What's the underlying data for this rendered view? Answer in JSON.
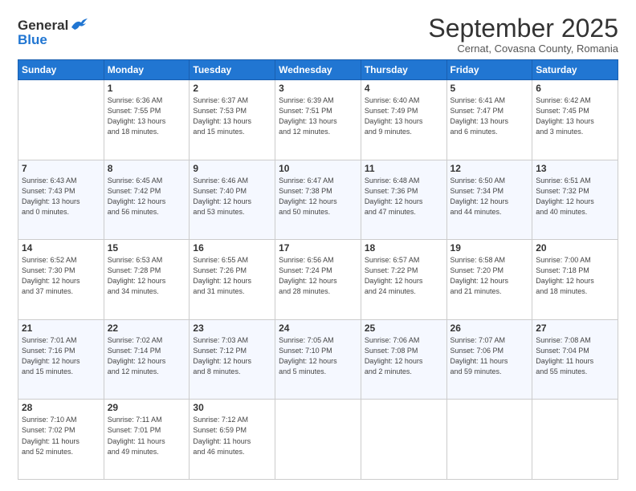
{
  "logo": {
    "general": "General",
    "blue": "Blue"
  },
  "title": "September 2025",
  "subtitle": "Cernat, Covasna County, Romania",
  "weekdays": [
    "Sunday",
    "Monday",
    "Tuesday",
    "Wednesday",
    "Thursday",
    "Friday",
    "Saturday"
  ],
  "weeks": [
    [
      {
        "day": "",
        "info": ""
      },
      {
        "day": "1",
        "info": "Sunrise: 6:36 AM\nSunset: 7:55 PM\nDaylight: 13 hours\nand 18 minutes."
      },
      {
        "day": "2",
        "info": "Sunrise: 6:37 AM\nSunset: 7:53 PM\nDaylight: 13 hours\nand 15 minutes."
      },
      {
        "day": "3",
        "info": "Sunrise: 6:39 AM\nSunset: 7:51 PM\nDaylight: 13 hours\nand 12 minutes."
      },
      {
        "day": "4",
        "info": "Sunrise: 6:40 AM\nSunset: 7:49 PM\nDaylight: 13 hours\nand 9 minutes."
      },
      {
        "day": "5",
        "info": "Sunrise: 6:41 AM\nSunset: 7:47 PM\nDaylight: 13 hours\nand 6 minutes."
      },
      {
        "day": "6",
        "info": "Sunrise: 6:42 AM\nSunset: 7:45 PM\nDaylight: 13 hours\nand 3 minutes."
      }
    ],
    [
      {
        "day": "7",
        "info": "Sunrise: 6:43 AM\nSunset: 7:43 PM\nDaylight: 13 hours\nand 0 minutes."
      },
      {
        "day": "8",
        "info": "Sunrise: 6:45 AM\nSunset: 7:42 PM\nDaylight: 12 hours\nand 56 minutes."
      },
      {
        "day": "9",
        "info": "Sunrise: 6:46 AM\nSunset: 7:40 PM\nDaylight: 12 hours\nand 53 minutes."
      },
      {
        "day": "10",
        "info": "Sunrise: 6:47 AM\nSunset: 7:38 PM\nDaylight: 12 hours\nand 50 minutes."
      },
      {
        "day": "11",
        "info": "Sunrise: 6:48 AM\nSunset: 7:36 PM\nDaylight: 12 hours\nand 47 minutes."
      },
      {
        "day": "12",
        "info": "Sunrise: 6:50 AM\nSunset: 7:34 PM\nDaylight: 12 hours\nand 44 minutes."
      },
      {
        "day": "13",
        "info": "Sunrise: 6:51 AM\nSunset: 7:32 PM\nDaylight: 12 hours\nand 40 minutes."
      }
    ],
    [
      {
        "day": "14",
        "info": "Sunrise: 6:52 AM\nSunset: 7:30 PM\nDaylight: 12 hours\nand 37 minutes."
      },
      {
        "day": "15",
        "info": "Sunrise: 6:53 AM\nSunset: 7:28 PM\nDaylight: 12 hours\nand 34 minutes."
      },
      {
        "day": "16",
        "info": "Sunrise: 6:55 AM\nSunset: 7:26 PM\nDaylight: 12 hours\nand 31 minutes."
      },
      {
        "day": "17",
        "info": "Sunrise: 6:56 AM\nSunset: 7:24 PM\nDaylight: 12 hours\nand 28 minutes."
      },
      {
        "day": "18",
        "info": "Sunrise: 6:57 AM\nSunset: 7:22 PM\nDaylight: 12 hours\nand 24 minutes."
      },
      {
        "day": "19",
        "info": "Sunrise: 6:58 AM\nSunset: 7:20 PM\nDaylight: 12 hours\nand 21 minutes."
      },
      {
        "day": "20",
        "info": "Sunrise: 7:00 AM\nSunset: 7:18 PM\nDaylight: 12 hours\nand 18 minutes."
      }
    ],
    [
      {
        "day": "21",
        "info": "Sunrise: 7:01 AM\nSunset: 7:16 PM\nDaylight: 12 hours\nand 15 minutes."
      },
      {
        "day": "22",
        "info": "Sunrise: 7:02 AM\nSunset: 7:14 PM\nDaylight: 12 hours\nand 12 minutes."
      },
      {
        "day": "23",
        "info": "Sunrise: 7:03 AM\nSunset: 7:12 PM\nDaylight: 12 hours\nand 8 minutes."
      },
      {
        "day": "24",
        "info": "Sunrise: 7:05 AM\nSunset: 7:10 PM\nDaylight: 12 hours\nand 5 minutes."
      },
      {
        "day": "25",
        "info": "Sunrise: 7:06 AM\nSunset: 7:08 PM\nDaylight: 12 hours\nand 2 minutes."
      },
      {
        "day": "26",
        "info": "Sunrise: 7:07 AM\nSunset: 7:06 PM\nDaylight: 11 hours\nand 59 minutes."
      },
      {
        "day": "27",
        "info": "Sunrise: 7:08 AM\nSunset: 7:04 PM\nDaylight: 11 hours\nand 55 minutes."
      }
    ],
    [
      {
        "day": "28",
        "info": "Sunrise: 7:10 AM\nSunset: 7:02 PM\nDaylight: 11 hours\nand 52 minutes."
      },
      {
        "day": "29",
        "info": "Sunrise: 7:11 AM\nSunset: 7:01 PM\nDaylight: 11 hours\nand 49 minutes."
      },
      {
        "day": "30",
        "info": "Sunrise: 7:12 AM\nSunset: 6:59 PM\nDaylight: 11 hours\nand 46 minutes."
      },
      {
        "day": "",
        "info": ""
      },
      {
        "day": "",
        "info": ""
      },
      {
        "day": "",
        "info": ""
      },
      {
        "day": "",
        "info": ""
      }
    ]
  ]
}
